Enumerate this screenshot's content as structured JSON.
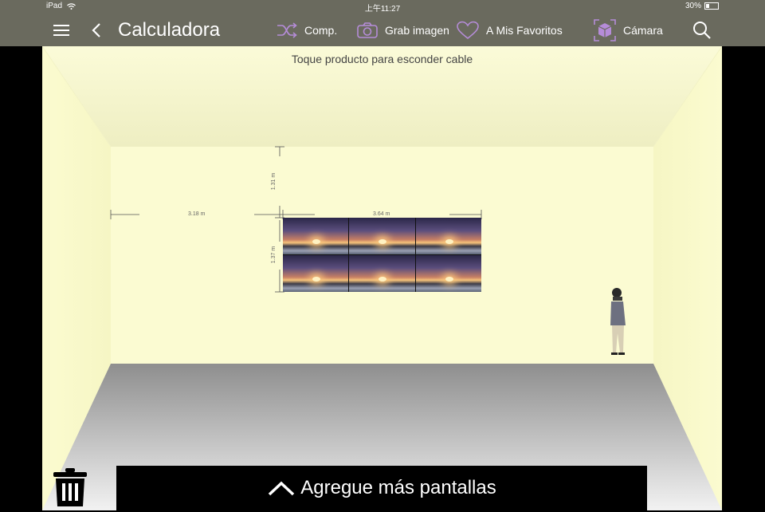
{
  "status_bar": {
    "device": "iPad",
    "time": "上午11:27",
    "battery": "30%",
    "battery_level": 0.3
  },
  "nav": {
    "title": "Calculadora",
    "compare_label": "Comp.",
    "capture_label": "Grab imagen",
    "favorites_label": "A Mis Favoritos",
    "camera_label": "Cámara",
    "icons": {
      "menu": "menu-icon",
      "back": "back-chevron-icon",
      "compare": "shuffle-icon",
      "capture": "camera-icon",
      "favorites": "heart-icon",
      "camera": "cube-camera-icon",
      "search": "search-icon"
    },
    "accent_color": "#b58cd8"
  },
  "room": {
    "hint": "Toque producto para esconder cable",
    "dim_left_distance": "3.18 m",
    "dim_width": "3.64 m",
    "dim_top_height": "1.31 m",
    "dim_screen_height": "1.37 m",
    "wall_color": "#fbfbd2",
    "floor_color": "#9c9c9c"
  },
  "bottom": {
    "add_screens_label": "Agregue más pantallas",
    "trash_icon": "trash-icon",
    "chevron_icon": "chevron-up-icon"
  }
}
